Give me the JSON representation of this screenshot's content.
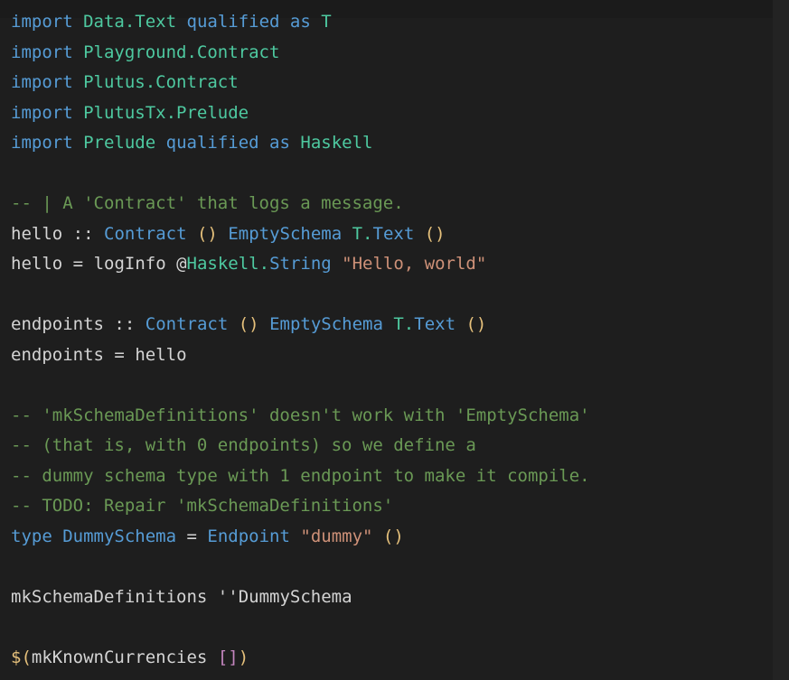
{
  "editor": {
    "language": "Haskell",
    "background_color": "#1e1e1e",
    "default_text_color": "#d4d4d4",
    "font_size_px": 19,
    "line_height_px": 33.5,
    "palette": {
      "keyword": "#569cd6",
      "module": "#4ec9a0",
      "type": "#569cd6",
      "comment": "#6a9955",
      "string": "#ce9178",
      "unit_parens": "#e5c07b",
      "splice_parens": "#e5c07b",
      "list_brackets": "#c586c0",
      "identifier": "#d4d4d4"
    }
  },
  "code": {
    "lines": [
      {
        "n": 1,
        "text": "import Data.Text qualified as T",
        "tokens": [
          {
            "t": "import",
            "c": "keyword"
          },
          {
            "t": " ",
            "c": "plain"
          },
          {
            "t": "Data.Text",
            "c": "module"
          },
          {
            "t": " ",
            "c": "plain"
          },
          {
            "t": "qualified",
            "c": "keyword"
          },
          {
            "t": " ",
            "c": "plain"
          },
          {
            "t": "as",
            "c": "keyword"
          },
          {
            "t": " ",
            "c": "plain"
          },
          {
            "t": "T",
            "c": "module"
          }
        ]
      },
      {
        "n": 2,
        "text": "import Playground.Contract",
        "tokens": [
          {
            "t": "import",
            "c": "keyword"
          },
          {
            "t": " ",
            "c": "plain"
          },
          {
            "t": "Playground.Contract",
            "c": "module"
          }
        ]
      },
      {
        "n": 3,
        "text": "import Plutus.Contract",
        "tokens": [
          {
            "t": "import",
            "c": "keyword"
          },
          {
            "t": " ",
            "c": "plain"
          },
          {
            "t": "Plutus.Contract",
            "c": "module"
          }
        ]
      },
      {
        "n": 4,
        "text": "import PlutusTx.Prelude",
        "tokens": [
          {
            "t": "import",
            "c": "keyword"
          },
          {
            "t": " ",
            "c": "plain"
          },
          {
            "t": "PlutusTx.Prelude",
            "c": "module"
          }
        ]
      },
      {
        "n": 5,
        "text": "import Prelude qualified as Haskell",
        "tokens": [
          {
            "t": "import",
            "c": "keyword"
          },
          {
            "t": " ",
            "c": "plain"
          },
          {
            "t": "Prelude",
            "c": "module"
          },
          {
            "t": " ",
            "c": "plain"
          },
          {
            "t": "qualified",
            "c": "keyword"
          },
          {
            "t": " ",
            "c": "plain"
          },
          {
            "t": "as",
            "c": "keyword"
          },
          {
            "t": " ",
            "c": "plain"
          },
          {
            "t": "Haskell",
            "c": "module"
          }
        ]
      },
      {
        "n": 6,
        "text": "",
        "tokens": []
      },
      {
        "n": 7,
        "text": "-- | A 'Contract' that logs a message.",
        "tokens": [
          {
            "t": "-- | A 'Contract' that logs a message.",
            "c": "comment"
          }
        ]
      },
      {
        "n": 8,
        "text": "hello :: Contract () EmptySchema T.Text ()",
        "tokens": [
          {
            "t": "hello",
            "c": "plain"
          },
          {
            "t": " ",
            "c": "plain"
          },
          {
            "t": "::",
            "c": "operator"
          },
          {
            "t": " ",
            "c": "plain"
          },
          {
            "t": "Contract",
            "c": "type"
          },
          {
            "t": " ",
            "c": "plain"
          },
          {
            "t": "()",
            "c": "unit"
          },
          {
            "t": " ",
            "c": "plain"
          },
          {
            "t": "EmptySchema",
            "c": "type"
          },
          {
            "t": " ",
            "c": "plain"
          },
          {
            "t": "T.",
            "c": "module"
          },
          {
            "t": "Text",
            "c": "type"
          },
          {
            "t": " ",
            "c": "plain"
          },
          {
            "t": "()",
            "c": "unit"
          }
        ]
      },
      {
        "n": 9,
        "text": "hello = logInfo @Haskell.String \"Hello, world\"",
        "tokens": [
          {
            "t": "hello",
            "c": "plain"
          },
          {
            "t": " ",
            "c": "plain"
          },
          {
            "t": "=",
            "c": "operator"
          },
          {
            "t": " ",
            "c": "plain"
          },
          {
            "t": "logInfo",
            "c": "plain"
          },
          {
            "t": " ",
            "c": "plain"
          },
          {
            "t": "@",
            "c": "operator"
          },
          {
            "t": "Haskell.",
            "c": "module"
          },
          {
            "t": "String",
            "c": "type"
          },
          {
            "t": " ",
            "c": "plain"
          },
          {
            "t": "\"Hello, world\"",
            "c": "string"
          }
        ]
      },
      {
        "n": 10,
        "text": "",
        "tokens": []
      },
      {
        "n": 11,
        "text": "endpoints :: Contract () EmptySchema T.Text ()",
        "tokens": [
          {
            "t": "endpoints",
            "c": "plain"
          },
          {
            "t": " ",
            "c": "plain"
          },
          {
            "t": "::",
            "c": "operator"
          },
          {
            "t": " ",
            "c": "plain"
          },
          {
            "t": "Contract",
            "c": "type"
          },
          {
            "t": " ",
            "c": "plain"
          },
          {
            "t": "()",
            "c": "unit"
          },
          {
            "t": " ",
            "c": "plain"
          },
          {
            "t": "EmptySchema",
            "c": "type"
          },
          {
            "t": " ",
            "c": "plain"
          },
          {
            "t": "T.",
            "c": "module"
          },
          {
            "t": "Text",
            "c": "type"
          },
          {
            "t": " ",
            "c": "plain"
          },
          {
            "t": "()",
            "c": "unit"
          }
        ]
      },
      {
        "n": 12,
        "text": "endpoints = hello",
        "tokens": [
          {
            "t": "endpoints",
            "c": "plain"
          },
          {
            "t": " ",
            "c": "plain"
          },
          {
            "t": "=",
            "c": "operator"
          },
          {
            "t": " ",
            "c": "plain"
          },
          {
            "t": "hello",
            "c": "plain"
          }
        ]
      },
      {
        "n": 13,
        "text": "",
        "tokens": []
      },
      {
        "n": 14,
        "text": "-- 'mkSchemaDefinitions' doesn't work with 'EmptySchema'",
        "tokens": [
          {
            "t": "-- 'mkSchemaDefinitions' doesn't work with 'EmptySchema'",
            "c": "comment"
          }
        ]
      },
      {
        "n": 15,
        "text": "-- (that is, with 0 endpoints) so we define a",
        "tokens": [
          {
            "t": "-- (that is, with 0 endpoints) so we define a",
            "c": "comment"
          }
        ]
      },
      {
        "n": 16,
        "text": "-- dummy schema type with 1 endpoint to make it compile.",
        "tokens": [
          {
            "t": "-- dummy schema type with 1 endpoint to make it compile.",
            "c": "comment"
          }
        ]
      },
      {
        "n": 17,
        "text": "-- TODO: Repair 'mkSchemaDefinitions'",
        "tokens": [
          {
            "t": "-- TODO: Repair 'mkSchemaDefinitions'",
            "c": "comment"
          }
        ]
      },
      {
        "n": 18,
        "text": "type DummySchema = Endpoint \"dummy\" ()",
        "tokens": [
          {
            "t": "type",
            "c": "keyword"
          },
          {
            "t": " ",
            "c": "plain"
          },
          {
            "t": "DummySchema",
            "c": "type"
          },
          {
            "t": " ",
            "c": "plain"
          },
          {
            "t": "=",
            "c": "operator"
          },
          {
            "t": " ",
            "c": "plain"
          },
          {
            "t": "Endpoint",
            "c": "type"
          },
          {
            "t": " ",
            "c": "plain"
          },
          {
            "t": "\"dummy\"",
            "c": "string"
          },
          {
            "t": " ",
            "c": "plain"
          },
          {
            "t": "()",
            "c": "unit"
          }
        ]
      },
      {
        "n": 19,
        "text": "",
        "tokens": []
      },
      {
        "n": 20,
        "text": "mkSchemaDefinitions ''DummySchema",
        "tokens": [
          {
            "t": "mkSchemaDefinitions",
            "c": "plain"
          },
          {
            "t": " ",
            "c": "plain"
          },
          {
            "t": "''",
            "c": "plain"
          },
          {
            "t": "DummySchema",
            "c": "plain"
          }
        ]
      },
      {
        "n": 21,
        "text": "",
        "tokens": []
      },
      {
        "n": 22,
        "text": "$(mkKnownCurrencies [])",
        "tokens": [
          {
            "t": "$(",
            "c": "splice"
          },
          {
            "t": "mkKnownCurrencies",
            "c": "plain"
          },
          {
            "t": " ",
            "c": "plain"
          },
          {
            "t": "[]",
            "c": "bracket"
          },
          {
            "t": ")",
            "c": "splice"
          }
        ]
      }
    ]
  }
}
